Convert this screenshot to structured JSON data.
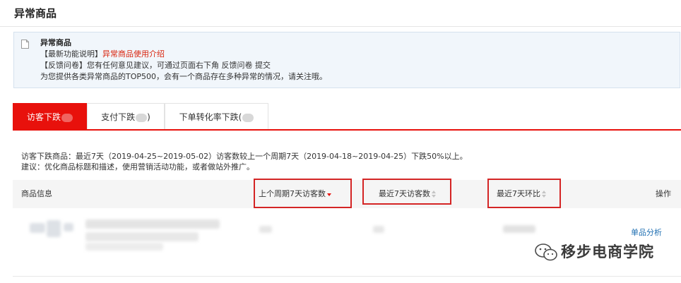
{
  "page": {
    "title": "异常商品"
  },
  "notice": {
    "title": "异常商品",
    "line1_prefix": "【最新功能说明】",
    "line1_link": "异常商品使用介绍",
    "line2": "【反馈问卷】您有任何意见建议，可通过页面右下角 反馈问卷 提交",
    "line3": "为您提供各类异常商品的TOP500，会有一个商品存在多种异常的情况，请关注哦。"
  },
  "tabs": [
    {
      "label": "访客下跌",
      "active": true
    },
    {
      "label": "支付下跌",
      "suffix": ")",
      "active": false
    },
    {
      "label": "下单转化率下跌(",
      "active": false
    }
  ],
  "summary": {
    "line1": "访客下跌商品：最近7天（2019-04-25~2019-05-02）访客数较上一个周期7天（2019-04-18~2019-04-25）下跌50%以上。",
    "line2": "建议：优化商品标题和描述，使用营销活动功能，或者做站外推广。"
  },
  "table": {
    "columns": {
      "product": "商品信息",
      "prev_visitors": "上个周期7天访客数",
      "recent_visitors": "最近7天访客数",
      "ratio": "最近7天环比",
      "action": "操作"
    },
    "row_action": "单品分析"
  },
  "watermark": {
    "text": "移步电商学院"
  },
  "colors": {
    "accent": "#e8110c",
    "highlight": "#d42525",
    "link": "#1f6fb2",
    "notice_bg": "#f1f6fb"
  }
}
